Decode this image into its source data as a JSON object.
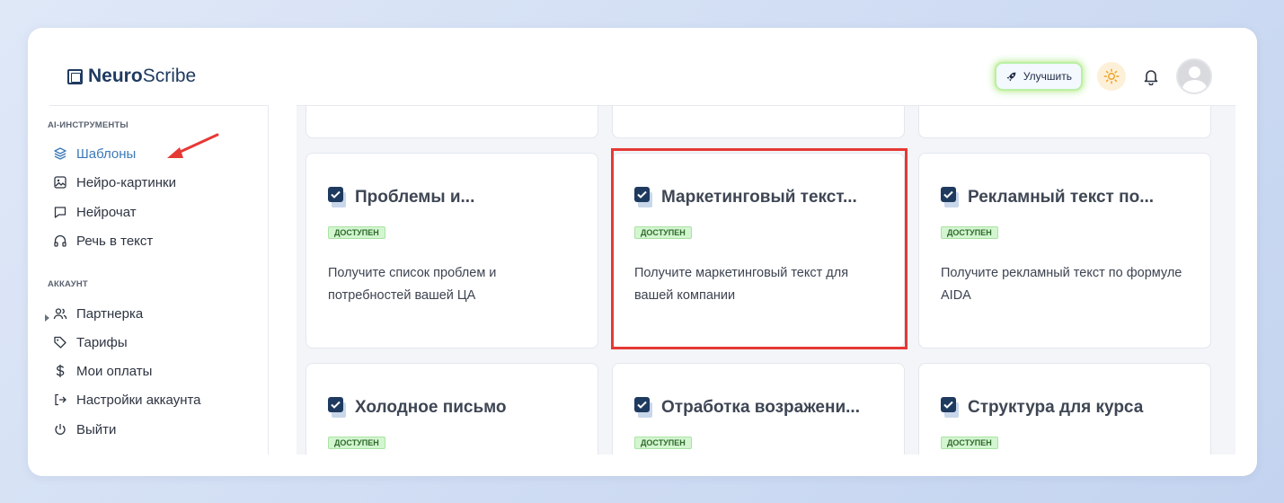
{
  "app": {
    "brand_bold": "Neuro",
    "brand_light": "Scribe"
  },
  "header": {
    "upgrade_label": "Улучшить"
  },
  "sidebar": {
    "section_tools": "AI-ИНСТРУМЕНТЫ",
    "tools": [
      {
        "label": "Шаблоны",
        "icon": "layers-icon",
        "active": true
      },
      {
        "label": "Нейро-картинки",
        "icon": "image-icon"
      },
      {
        "label": "Нейрочат",
        "icon": "chat-icon"
      },
      {
        "label": "Речь в текст",
        "icon": "headphones-icon"
      }
    ],
    "section_account": "АККАУНТ",
    "account": [
      {
        "label": "Партнерка",
        "icon": "users-icon"
      },
      {
        "label": "Тарифы",
        "icon": "tag-icon"
      },
      {
        "label": "Мои оплаты",
        "icon": "dollar-icon"
      },
      {
        "label": "Настройки аккаунта",
        "icon": "login-icon"
      },
      {
        "label": "Выйти",
        "icon": "power-icon"
      }
    ]
  },
  "cards": [
    {
      "title": "Проблемы и...",
      "badge": "ДОСТУПЕН",
      "desc": "Получите список проблем и потребностей вашей ЦА"
    },
    {
      "title": "Маркетинговый текст...",
      "badge": "ДОСТУПЕН",
      "desc": "Получите маркетинговый текст для вашей компании"
    },
    {
      "title": "Рекламный текст по...",
      "badge": "ДОСТУПЕН",
      "desc": "Получите рекламный текст по формуле AIDA"
    },
    {
      "title": "Холодное письмо",
      "badge": "ДОСТУПЕН",
      "desc": ""
    },
    {
      "title": "Отработка возражени...",
      "badge": "ДОСТУПЕН",
      "desc": ""
    },
    {
      "title": "Структура для курса",
      "badge": "ДОСТУПЕН",
      "desc": ""
    }
  ],
  "colors": {
    "accent": "#3b79b8",
    "highlight": "#e53935",
    "badge_bg": "#d3f5d0"
  }
}
